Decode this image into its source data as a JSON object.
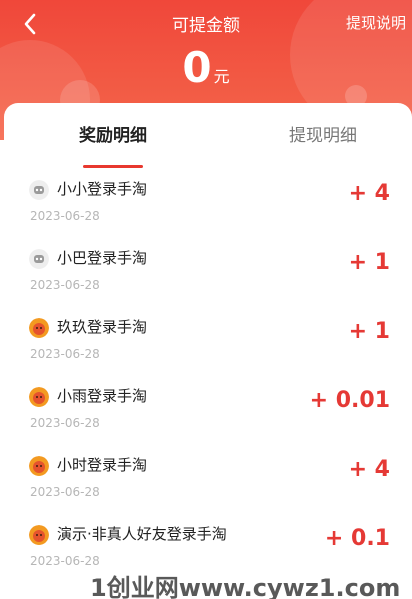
{
  "header": {
    "title": "可提金额",
    "help_label": "提现说明",
    "amount": "0",
    "unit": "元",
    "back_icon": "chevron-left-icon"
  },
  "tabs": [
    {
      "label": "奖励明细",
      "active": true
    },
    {
      "label": "提现明细",
      "active": false
    }
  ],
  "records": [
    {
      "name": "小小登录手淘",
      "date": "2023-06-28",
      "reward": "+ 4",
      "avatar": "robot-avatar-icon"
    },
    {
      "name": "小巴登录手淘",
      "date": "2023-06-28",
      "reward": "+ 1",
      "avatar": "robot-avatar-icon"
    },
    {
      "name": "玖玖登录手淘",
      "date": "2023-06-28",
      "reward": "+ 1",
      "avatar": "orange-face-avatar-icon"
    },
    {
      "name": "小雨登录手淘",
      "date": "2023-06-28",
      "reward": "+ 0.01",
      "avatar": "orange-face-avatar-icon"
    },
    {
      "name": "小时登录手淘",
      "date": "2023-06-28",
      "reward": "+ 4",
      "avatar": "orange-face-avatar-icon"
    },
    {
      "name": "演示·非真人好友登录手淘",
      "date": "2023-06-28",
      "reward": "+ 0.1",
      "avatar": "orange-face-avatar-icon"
    }
  ],
  "watermark": "1创业网www.cywz1.com",
  "colors": {
    "header_red": "#f0473a",
    "reward_red": "#e53935",
    "tab_underline": "#e8382e"
  }
}
